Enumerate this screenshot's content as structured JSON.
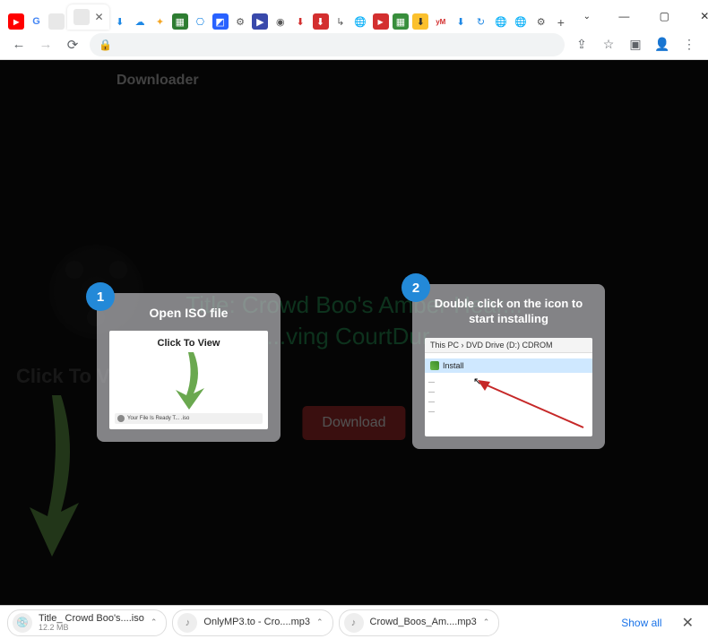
{
  "window": {
    "drop": "⌄",
    "min": "—",
    "max": "▢",
    "close": "✕"
  },
  "tabs": {
    "newtab": "+",
    "active_close": "✕"
  },
  "addr": {
    "back": "←",
    "fwd": "→",
    "reload": "⟳",
    "lock": "🔒",
    "share": "⇪",
    "star": "☆",
    "panel": "▣",
    "profile": "👤",
    "menu": "⋮"
  },
  "page": {
    "brand": "Downloader",
    "title": "Title: Crowd Boo's Amber Hear... ....ving CourtDur...",
    "download": "Download",
    "click_to_view": "Click To View",
    "watermark_line1": "",
    "watermark_line2": ""
  },
  "card1": {
    "badge": "1",
    "title": "Open ISO file",
    "inner_text": "Click To View",
    "bar_text": "Your File Is Ready T... .iso"
  },
  "card2": {
    "badge": "2",
    "title": "Double click on the icon to start installing",
    "crumb": "This PC  ›  DVD Drive (D:) CDROM",
    "install": "Install"
  },
  "downloads": {
    "item1": {
      "name": "Title_ Crowd Boo's....iso",
      "size": "12.2 MB"
    },
    "item2": {
      "name": "OnlyMP3.to - Cro....mp3"
    },
    "item3": {
      "name": "Crowd_Boos_Am....mp3"
    },
    "showall": "Show all",
    "close": "✕",
    "chev": "⌃"
  }
}
